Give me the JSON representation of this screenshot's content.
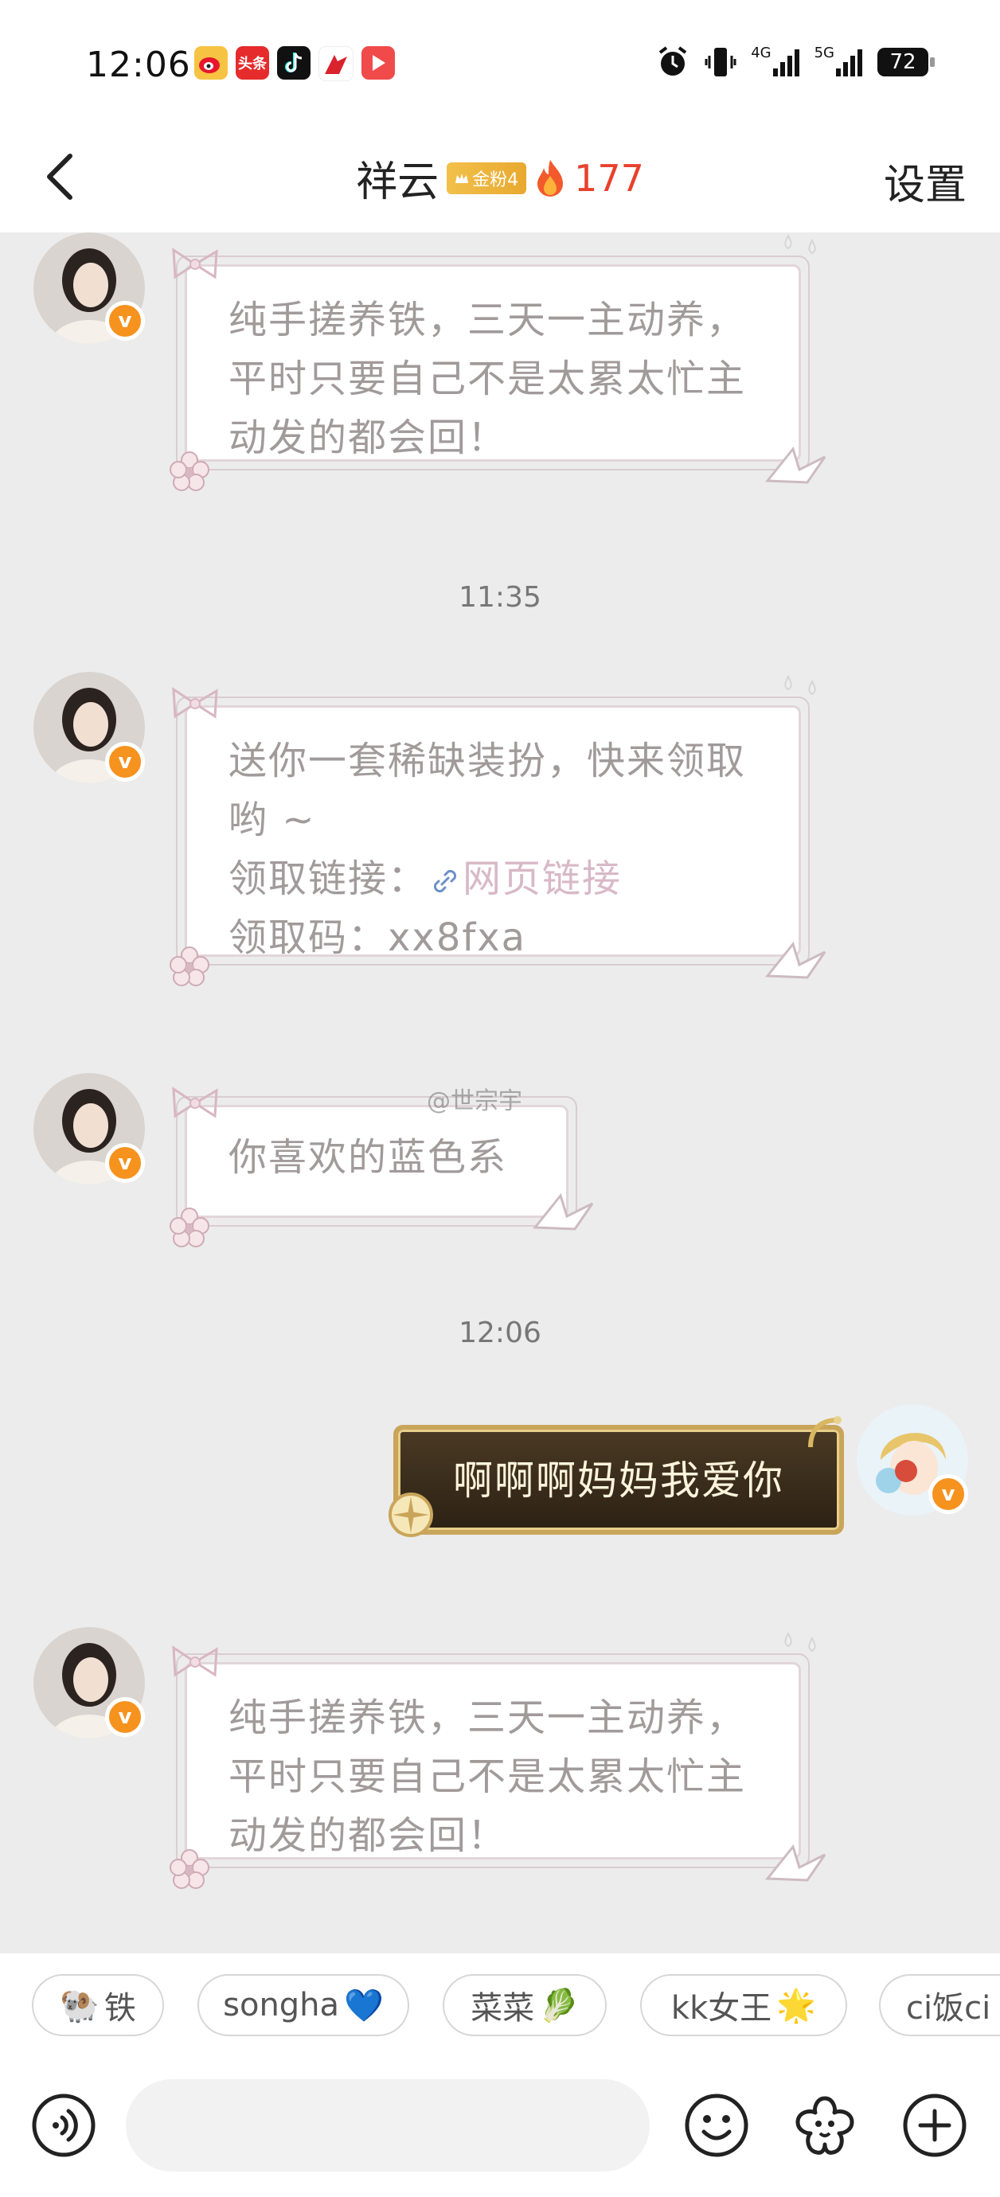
{
  "status_bar": {
    "time": "12:06",
    "app_icons": [
      "weibo-icon",
      "toutiao-icon",
      "tiktok-icon",
      "reading-app-icon",
      "video-app-icon"
    ],
    "toutiao_label": "头条",
    "network_4g": "4G",
    "network_5g": "5G",
    "battery": "72"
  },
  "nav": {
    "title": "祥云",
    "fan_badge": "金粉4",
    "fire_count": "177",
    "settings": "设置"
  },
  "messages": [
    {
      "from": "other",
      "text": "纯手搓养铁，三天一主动养，平时只要自己不是太累太忙主动发的都会回！"
    },
    {
      "type": "time",
      "text": "11:35"
    },
    {
      "from": "other",
      "line1": "送你一套稀缺装扮，快来领取哟 ~",
      "link_label": "领取链接：",
      "link_text": "网页链接",
      "code": "领取码：xx8fxa"
    },
    {
      "from": "other",
      "text": "你喜欢的蓝色系"
    },
    {
      "type": "time",
      "text": "12:06"
    },
    {
      "from": "me",
      "text": "啊啊啊妈妈我爱你"
    },
    {
      "from": "other",
      "text": "纯手搓养铁，三天一主动养，平时只要自己不是太累太忙主动发的都会回！"
    }
  ],
  "watermark": "@世宗宇",
  "quick_replies": [
    {
      "label": "铁",
      "emoji": "🐏"
    },
    {
      "label": "songha",
      "emoji": "💙"
    },
    {
      "label": "菜菜",
      "emoji": "🥬"
    },
    {
      "label": "kk女王",
      "emoji": "🌟"
    },
    {
      "label": "ci饭ci",
      "emoji": ""
    }
  ],
  "input": {
    "placeholder": "",
    "value": ""
  },
  "colors": {
    "accent_fire": "#e8412c",
    "verified_badge": "#f6921e",
    "link": "#d8b9c6"
  }
}
